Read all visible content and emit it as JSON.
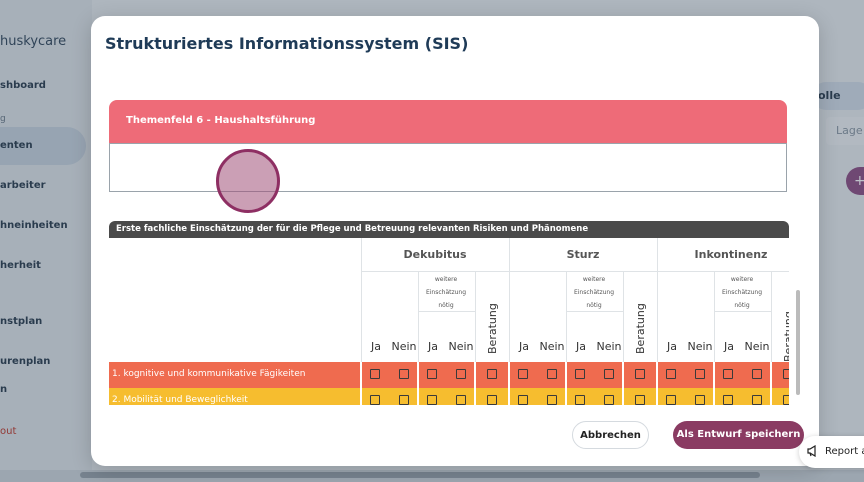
{
  "background": {
    "logo": "huskycare",
    "nav": [
      "shboard",
      "g",
      "enten",
      "arbeiter",
      "hneinheiten",
      "herheit",
      "nstplan",
      "urenplan",
      "n",
      "out"
    ],
    "right_button": "olle",
    "right_input": "Lage",
    "right_plus": "+"
  },
  "modal": {
    "title": "Strukturiertes Informationssystem (SIS)",
    "theme_header": "Themenfeld 6 - Haushaltsführung",
    "theme_text": "",
    "matrix_title": "Erste fachliche Einschätzung der für die Pflege und Betreuung relevanten Risiken und Phänomene",
    "groups": [
      "Dekubitus",
      "Sturz",
      "Inkontinenz"
    ],
    "weitere_line1": "weitere",
    "weitere_line2": "Einschätzung",
    "weitere_line3": "nötig",
    "ja": "Ja",
    "nein": "Nein",
    "beratung": "Beratung",
    "rows": [
      {
        "label": "1. kognitive und kommunikative Fägikeiten",
        "color": "#ef6b4f"
      },
      {
        "label": "2. Mobilität und Beweglichkeit",
        "color": "#f6bd2f"
      },
      {
        "label": "",
        "color": "#8bc34a"
      }
    ],
    "cancel_label": "Abbrechen",
    "save_label": "Als Entwurf speichern"
  },
  "report_label": "Report a"
}
